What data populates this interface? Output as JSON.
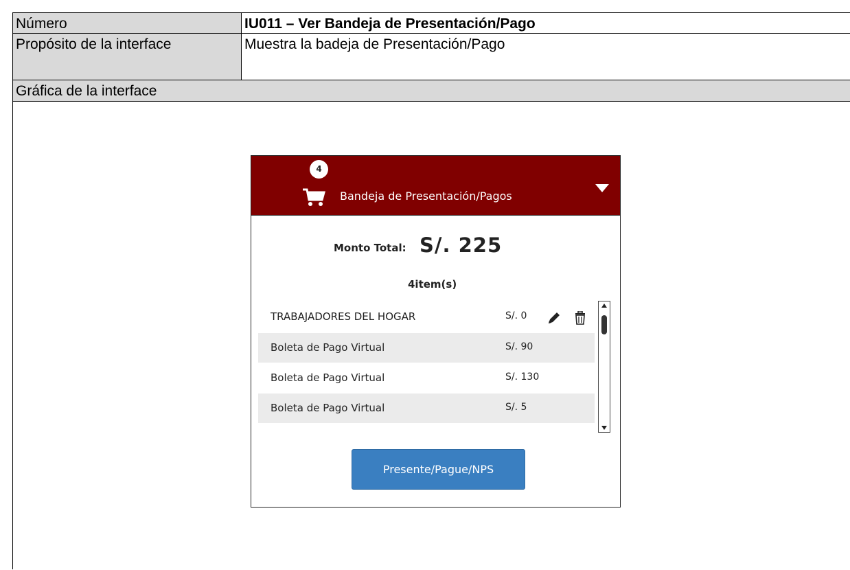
{
  "doc": {
    "numero_label": "Número",
    "numero_value": "IU011 – Ver Bandeja de Presentación/Pago",
    "proposito_label": "Propósito de la interface",
    "proposito_value": "Muestra la badeja de Presentación/Pago",
    "grafica_label": "Gráfica de la interface"
  },
  "widget": {
    "badge_count": "4",
    "title": "Bandeja de Presentación/Pagos",
    "total_label": "Monto Total:",
    "total_value": "S/. 225",
    "items_count": "4item(s)",
    "items": [
      {
        "name": "TRABAJADORES DEL HOGAR",
        "amount": "S/. 0"
      },
      {
        "name": "Boleta de Pago Virtual",
        "amount": "S/. 90"
      },
      {
        "name": "Boleta de Pago Virtual",
        "amount": "S/. 130"
      },
      {
        "name": "Boleta de Pago Virtual",
        "amount": "S/. 5"
      }
    ],
    "button_label": "Presente/Pague/NPS",
    "icons": [
      "cart-icon",
      "chevron-down-icon",
      "pencil-icon",
      "trash-icon",
      "scroll-up-icon",
      "scroll-down-icon"
    ],
    "colors": {
      "header": "#800000",
      "button": "#3a7fc1",
      "row_shade": "#ebebeb",
      "row_header": "#d9d9d9"
    }
  }
}
